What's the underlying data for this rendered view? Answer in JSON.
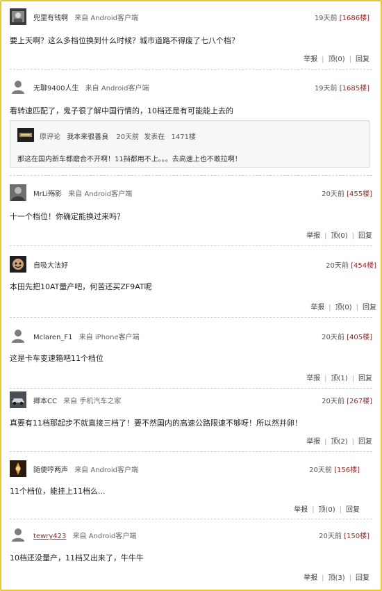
{
  "comments": [
    {
      "user": "兜里有钱啊",
      "source": "来自 Android客户端",
      "time": "19天前",
      "floor": "1686楼",
      "text": "要上天啊？这么多档位换到什么时候？城市道路不得废了七八个档？",
      "report": "举报",
      "up": "顶(0)",
      "reply": "回复",
      "avatar": "profile-photo-icon"
    },
    {
      "user": "无聊9400人生",
      "source": "来自 Android客户端",
      "time": "19天前",
      "floor": "1685楼",
      "text": "看转速匹配了，鬼子很了解中国行情的，10档还是有可能能上去的",
      "avatar": "default-user-icon",
      "quote": {
        "label": "原评论",
        "user": "我本来很善良",
        "time": "20天前",
        "posted_at": "发表在",
        "floor": "1471楼",
        "text": "那这在国内新车都磨合不开啊！11挡都用不上。。。去高速上也不敢拉啊！"
      }
    },
    {
      "user": "MrLi殇影",
      "source": "来自 Android客户端",
      "time": "20天前",
      "floor": "455楼",
      "text": "十一个档位！你确定能换过来吗？",
      "report": "举报",
      "up": "顶(0)",
      "reply": "回复",
      "avatar": "profile-photo-icon"
    },
    {
      "user": "自吸大法好",
      "source": "",
      "time": "20天前",
      "floor": "454楼",
      "text": "本田先把10AT量产吧，何苦还买ZF9AT呢",
      "report": "举报",
      "up": "顶(0)",
      "reply": "回复",
      "avatar": "profile-photo-icon"
    },
    {
      "user": "Mclaren_F1",
      "source": "来自 iPhone客户端",
      "time": "20天前",
      "floor": "405楼",
      "text": "这是卡车变速箱吧11个档位",
      "report": "举报",
      "up": "顶(1)",
      "reply": "回复",
      "avatar": "default-user-icon"
    },
    {
      "user": "卿本CC",
      "source": "来自 手机汽车之家",
      "time": "20天前",
      "floor": "267楼",
      "text": "真要有11档那起步不就直接三档了！要不然国内的高速公路限速不够呀！所以然并卵！",
      "report": "举报",
      "up": "顶(2)",
      "reply": "回复",
      "avatar": "profile-photo-icon"
    },
    {
      "user": "随便哼两声",
      "source": "来自 Android客户端",
      "time": "20天前",
      "floor": "156楼",
      "text": "11个档位，能挂上11档么...",
      "report": "举报",
      "up": "顶(0)",
      "reply": "回复",
      "avatar": "profile-photo-icon"
    },
    {
      "user": "tewry423",
      "source": "来自 Android客户端",
      "time": "20天前",
      "floor": "150楼",
      "text": "10档还没量产，11档又出来了，牛牛牛",
      "report": "举报",
      "up": "顶(3)",
      "reply": "回复",
      "avatar": "default-user-icon"
    }
  ],
  "colors": {
    "frame": "#e3c93a",
    "floor": "#8a2b2b",
    "divider": "#cfcfcf"
  }
}
